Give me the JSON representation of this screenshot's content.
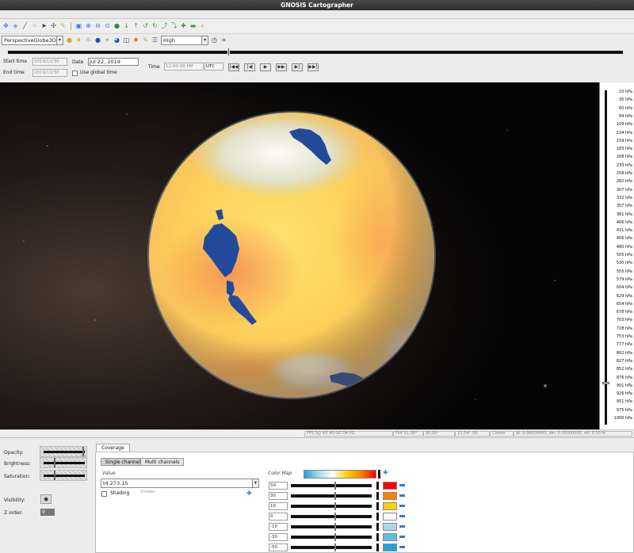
{
  "app": {
    "title": "GNOSIS Cartographer"
  },
  "toolbar2": {
    "projection": "PerspectiveGlobe3D",
    "quality": "High"
  },
  "time": {
    "start_label": "Start time",
    "end_label": "End time",
    "start_value": "2019/12/30",
    "end_value": "2019/12/30",
    "date_label": "Date",
    "date_value": "Jul 22, 2019",
    "global_time_label": "Use global time",
    "time_label": "Time",
    "time_value": "12:00:00 PM",
    "timezone": "UTC",
    "nav_buttons": [
      "|◀◀",
      "|◀",
      "▶",
      "▶▶",
      "▶|",
      "▶▶|"
    ]
  },
  "pressure_levels": [
    "10 hPa",
    "35 hPa",
    "60 hPa",
    "84 hPa",
    "109 hPa",
    "134 hPa",
    "159 hPa",
    "183 hPa",
    "208 hPa",
    "233 hPa",
    "258 hPa",
    "282 hPa",
    "307 hPa",
    "332 hPa",
    "357 hPa",
    "381 hPa",
    "406 hPa",
    "431 hPa",
    "456 hPa",
    "480 hPa",
    "505 hPa",
    "530 hPa",
    "555 hPa",
    "579 hPa",
    "604 hPa",
    "629 hPa",
    "654 hPa",
    "678 hPa",
    "703 hPa",
    "728 hPa",
    "753 hPa",
    "777 hPa",
    "802 hPa",
    "827 hPa",
    "852 hPa",
    "876 hPa",
    "901 hPa",
    "926 hPa",
    "951 hPa",
    "975 hPa",
    "1000 hPa"
  ],
  "selected_pressure_level": "876 hPa",
  "status": {
    "fov": "FoV 51.00°",
    "heading": "90.00°",
    "tilt": "11.54° (N)",
    "cursor": "Cursor",
    "position": "at: 0.00000000, lon: 0.00000000, alt: 0.00 m"
  },
  "layer_props": {
    "opacity_label": "Opacity:",
    "brightness_label": "Brightness:",
    "saturation_label": "Saturation:",
    "visibility_label": "Visibility:",
    "zorder_label": "Z order:",
    "zorder_value": "0",
    "opacity": 0.95,
    "brightness": 0.25,
    "saturation": 0.25
  },
  "coverage": {
    "tab_label": "Coverage",
    "single_channel": "Single channel",
    "multi_channels": "Multi channels",
    "value_label": "Value",
    "value_text": "t4  273.15",
    "shading_label": "Shading",
    "shading_hint": "Shades",
    "colormap_label": "Color Map",
    "colormap_rows": [
      {
        "value": "50",
        "color": "#ff0000",
        "level": 0.55
      },
      {
        "value": "30",
        "color": "#ff7f00",
        "level": 0.55
      },
      {
        "value": "10",
        "color": "#ffd100",
        "level": 0.55
      },
      {
        "value": "0",
        "color": "#ffffff",
        "level": 0.55
      },
      {
        "value": "-10",
        "color": "#a8d8e6",
        "level": 0.55
      },
      {
        "value": "-30",
        "color": "#5fbfe0",
        "level": 0.55
      },
      {
        "value": "-50",
        "color": "#1fa3e0",
        "level": 0.55
      }
    ]
  }
}
